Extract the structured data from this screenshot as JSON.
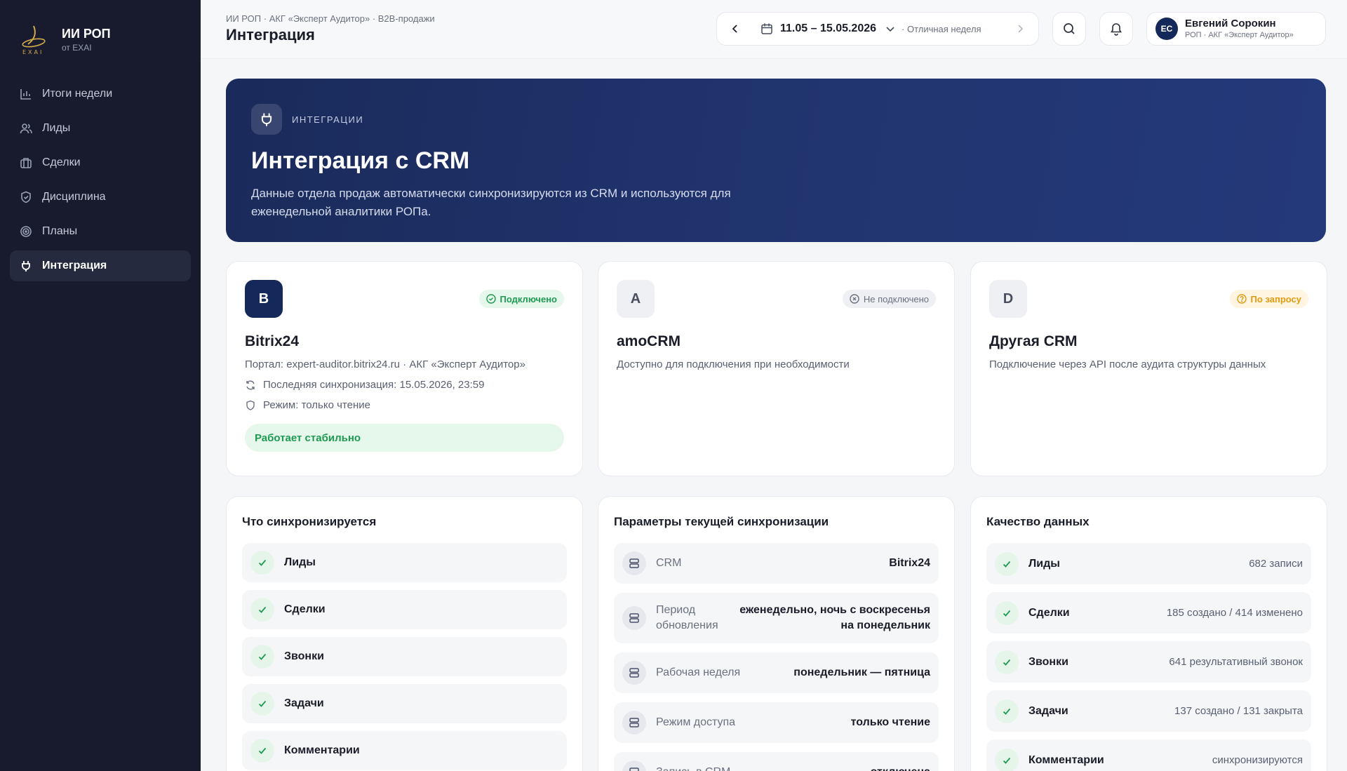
{
  "brand": {
    "title": "ИИ РОП",
    "subtitle": "от EXAI",
    "logo_text": "EXAI"
  },
  "sidebar": {
    "items": [
      {
        "label": "Итоги недели",
        "icon": "bar-chart-icon"
      },
      {
        "label": "Лиды",
        "icon": "users-icon"
      },
      {
        "label": "Сделки",
        "icon": "briefcase-icon"
      },
      {
        "label": "Дисциплина",
        "icon": "shield-icon"
      },
      {
        "label": "Планы",
        "icon": "target-icon"
      },
      {
        "label": "Интеграция",
        "icon": "plug-icon",
        "active": true
      }
    ]
  },
  "header": {
    "breadcrumb": "ИИ РОП · АКГ «Эксперт Аудитор» · B2B-продажи",
    "title": "Интеграция",
    "week_range": "11.05 – 15.05.2026",
    "week_status": "· Отличная неделя",
    "user": {
      "initials": "ЕС",
      "name": "Евгений Сорокин",
      "role": "РОП · АКГ «Эксперт Аудитор»"
    }
  },
  "hero": {
    "tag": "ИНТЕГРАЦИИ",
    "title": "Интеграция с CRM",
    "description": "Данные отдела продаж автоматически синхронизируются из CRM и используются для еженедельной аналитики РОПа."
  },
  "crm": [
    {
      "logo": "B",
      "name": "Bitrix24",
      "badge": "Подключено",
      "status": "ok",
      "description": "Портал: expert-auditor.bitrix24.ru · АКГ «Эксперт Аудитор»",
      "last_sync": "Последняя синхронизация: 15.05.2026, 23:59",
      "mode": "Режим: только чтение",
      "health": "Работает стабильно"
    },
    {
      "logo": "A",
      "name": "amoCRM",
      "badge": "Не подключено",
      "status": "off",
      "description": "Доступно для подключения при необходимости"
    },
    {
      "logo": "D",
      "name": "Другая CRM",
      "badge": "По запросу",
      "status": "req",
      "description": "Подключение через API после аудита структуры данных"
    }
  ],
  "sync_panel": {
    "title": "Что синхронизируется",
    "items": [
      "Лиды",
      "Сделки",
      "Звонки",
      "Задачи",
      "Комментарии"
    ]
  },
  "params_panel": {
    "title": "Параметры текущей синхронизации",
    "items": [
      {
        "label": "CRM",
        "value": "Bitrix24"
      },
      {
        "label": "Период обновления",
        "value": "еженедельно, ночь с воскресенья на понедельник"
      },
      {
        "label": "Рабочая неделя",
        "value": "понедельник — пятница"
      },
      {
        "label": "Режим доступа",
        "value": "только чтение"
      },
      {
        "label": "Запись в CRM",
        "value": "отключена"
      }
    ]
  },
  "quality_panel": {
    "title": "Качество данных",
    "items": [
      {
        "label": "Лиды",
        "value": "682 записи"
      },
      {
        "label": "Сделки",
        "value": "185 создано / 414 изменено"
      },
      {
        "label": "Звонки",
        "value": "641 результативный звонок"
      },
      {
        "label": "Задачи",
        "value": "137 создано / 131 закрыта"
      },
      {
        "label": "Комментарии",
        "value": "синхронизируются"
      }
    ]
  }
}
